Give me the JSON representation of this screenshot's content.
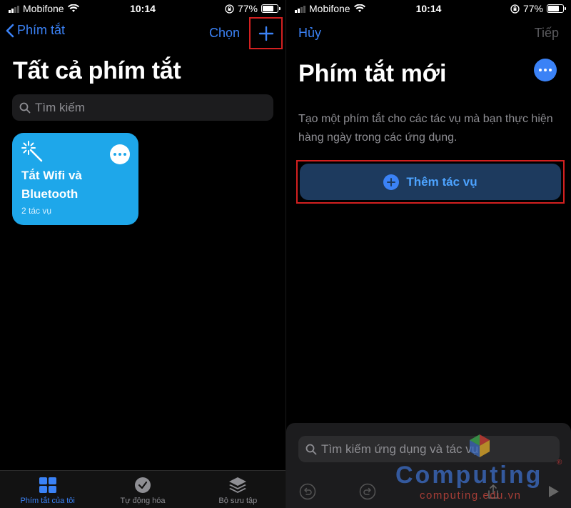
{
  "status": {
    "carrier": "Mobifone",
    "time": "10:14",
    "battery": "77%",
    "battery_level": 77
  },
  "left": {
    "back_label": "Phím tắt",
    "select_label": "Chọn",
    "title": "Tất cả phím tắt",
    "search_placeholder": "Tìm kiếm",
    "card": {
      "title": "Tắt Wifi và Bluetooth",
      "subtitle": "2 tác vụ",
      "color": "#1ea7ea"
    },
    "tabs": [
      {
        "label": "Phím tắt của tôi",
        "icon": "grid-icon",
        "active": true
      },
      {
        "label": "Tự động hóa",
        "icon": "clock-check-icon",
        "active": false
      },
      {
        "label": "Bộ sưu tập",
        "icon": "layers-icon",
        "active": false
      }
    ]
  },
  "right": {
    "cancel_label": "Hủy",
    "next_label": "Tiếp",
    "title": "Phím tắt mới",
    "description": "Tạo một phím tắt cho các tác vụ mà bạn thực hiện hàng ngày trong các ứng dụng.",
    "add_action_label": "Thêm tác vụ",
    "sheet_search_placeholder": "Tìm kiếm ứng dụng và tác vụ"
  },
  "watermark": {
    "brand": "Computing",
    "registered": "®",
    "url": "computing.edu.vn"
  },
  "colors": {
    "accent": "#3b82f6",
    "highlight_box": "#d32020"
  }
}
